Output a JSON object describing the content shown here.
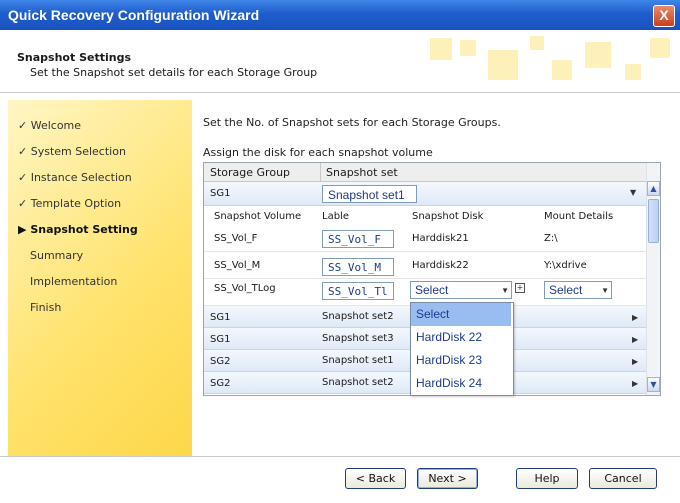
{
  "window": {
    "title": "Quick Recovery Configuration Wizard",
    "close_label": "X"
  },
  "header": {
    "title": "Snapshot Settings",
    "subtitle": "Set the Snapshot set details for each Storage Group"
  },
  "sidebar": {
    "items": [
      {
        "label": "Welcome",
        "done": true
      },
      {
        "label": "System Selection",
        "done": true
      },
      {
        "label": "Instance Selection",
        "done": true
      },
      {
        "label": "Template Option",
        "done": true
      },
      {
        "label": "Snapshot Setting",
        "current": true
      },
      {
        "label": "Summary"
      },
      {
        "label": "Implementation"
      },
      {
        "label": "Finish"
      }
    ],
    "check_glyph": "✓",
    "current_glyph": "▶"
  },
  "main": {
    "instruction": "Set the No. of Snapshot sets for each Storage Groups.",
    "assign_label": "Assign the disk for each snapshot volume",
    "grid": {
      "columns": [
        "Storage Group",
        "Snapshot set"
      ],
      "expanded_group": {
        "group": "SG1",
        "set": "Snapshot set1"
      },
      "sub_columns": [
        "Snapshot Volume",
        "Lable",
        "Snapshot Disk",
        "Mount Details"
      ],
      "volumes": [
        {
          "volume": "SS_Vol_F",
          "label": "SS_Vol_F",
          "disk": "Harddisk21",
          "mount": "Z:\\"
        },
        {
          "volume": "SS_Vol_M",
          "label": "SS_Vol_M",
          "disk": "Harddisk22",
          "mount": "Y:\\xdrive"
        },
        {
          "volume": "SS_Vol_TLog",
          "label": "SS_Vol_Tl",
          "disk": "Select",
          "mount": "Select"
        }
      ],
      "rows": [
        {
          "group": "SG1",
          "set": "Snapshot set2"
        },
        {
          "group": "SG1",
          "set": "Snapshot set3"
        },
        {
          "group": "SG2",
          "set": "Snapshot set1"
        },
        {
          "group": "SG2",
          "set": "Snapshot set2"
        }
      ]
    },
    "dropdown": {
      "options": [
        "Select",
        "HardDisk 22",
        "HardDisk 23",
        "HardDisk 24"
      ],
      "selected": "Select"
    }
  },
  "footer": {
    "back": "< Back",
    "next": "Next >",
    "help": "Help",
    "cancel": "Cancel"
  }
}
